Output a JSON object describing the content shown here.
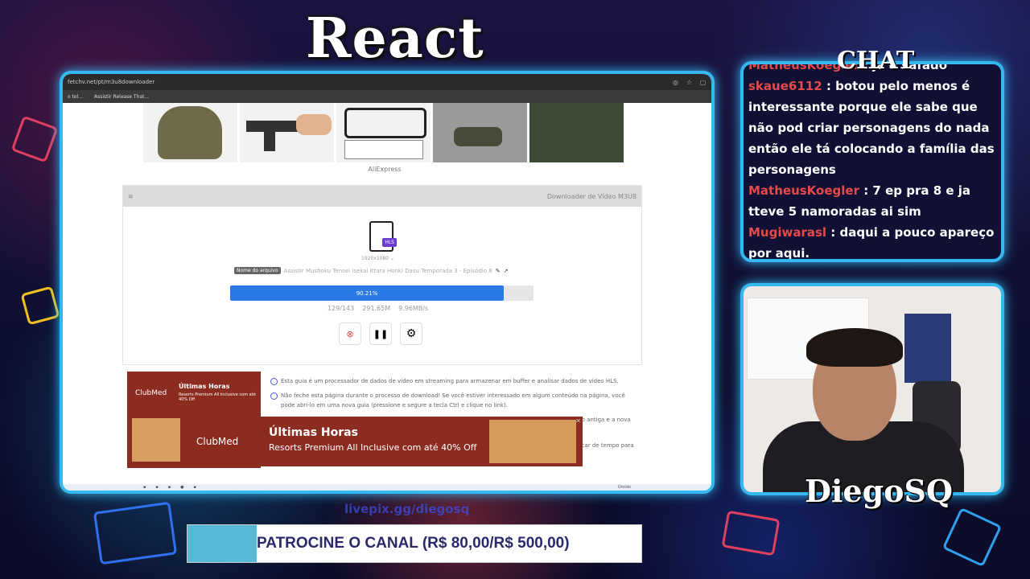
{
  "overlay": {
    "react_title": "React",
    "chat_title": "CHAT",
    "streamer_name": "DiegoSQ",
    "sponsor_link": "livepix.gg/diegosq",
    "sponsor_text": "PATROCINE O CANAL (R$ 80,00/R$ 500,00)"
  },
  "chat": {
    "messages": [
      {
        "user": "MatheusKoegler",
        "sep": " : ",
        "text": "ja e safado"
      },
      {
        "user": "skaue6112",
        "sep": " : ",
        "text": "botou pelo menos é interessante porque ele sabe que não pod criar personagens do nada então ele tá colocando a família das personagens"
      },
      {
        "user": "MatheusKoegler",
        "sep": " : ",
        "text": "7 ep pra 8 e ja tteve 5 namoradas ai sim"
      },
      {
        "user": "Mugiwarasl",
        "sep": " : ",
        "text": "daqui a pouco apareço por aqui."
      }
    ]
  },
  "browser": {
    "url": "fetchv.net/pt/m3u8downloader",
    "bookmarks": [
      "o tel...",
      "Assistir Release That..."
    ],
    "ali_label": "AliExpress",
    "downloader_title": "Downloader de Vídeo M3U8",
    "hls_badge": "HLS",
    "resolution": "1920x1080",
    "name_tag": "Nome do arquivo",
    "file_name": "Assistir Mushoku Tensei Isekai Ittara Honki Dasu Temporada 3 - Episódio 8",
    "progress_label": "90.21%",
    "progress_value": 0.9021,
    "segments": "129/143",
    "size": "291.65M",
    "speed": "9.96MB/s",
    "info_items": [
      "Esta guia é um processador de dados de vídeo em streaming para armazenar em buffer e analisar dados de vídeo HLS.",
      "Não feche esta página durante o processo de download! Se você estiver interessado em algum conteúdo na página, você pode abri-lo em uma nova guia (pressione e segure a tecla Ctrl e clique no link)."
    ],
    "info_partial_1": "...o antiga e a nova",
    "info_partial_2": "...car de tempo para",
    "ad_small": {
      "brand": "ClubMed",
      "headline": "Últimas Horas",
      "sub": "Resorts Premium All Inclusive com até 40% Off"
    },
    "ad_banner": {
      "brand": "ClubMed",
      "headline": "Últimas Horas",
      "sub": "Resorts Premium All Inclusive com até 40% Off"
    },
    "taskbar_weather": "Úmido"
  }
}
